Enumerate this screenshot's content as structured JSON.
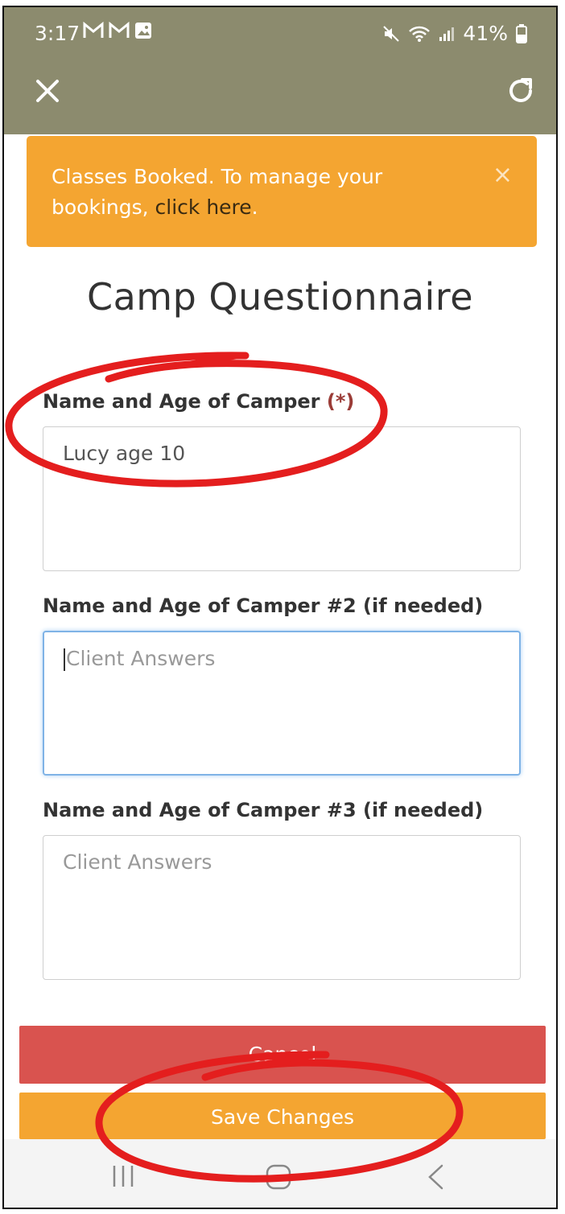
{
  "status_bar": {
    "time": "3:17",
    "notifications": [
      "gmail-icon",
      "gmail-icon",
      "image-icon"
    ],
    "battery": "41%"
  },
  "alert": {
    "text_prefix": "Classes Booked. To manage your bookings, ",
    "link_text": "click here",
    "text_suffix": ".",
    "close_label": "×"
  },
  "page": {
    "title": "Camp Questionnaire"
  },
  "form": {
    "fields": [
      {
        "label": "Name and Age of Camper",
        "required_mark": "(*)",
        "value": "Lucy age 10",
        "placeholder": "Client Answers"
      },
      {
        "label": "Name and Age of Camper #2 (if needed)",
        "value": "",
        "placeholder": "Client Answers"
      },
      {
        "label": "Name and Age of Camper #3 (if needed)",
        "value": "",
        "placeholder": "Client Answers"
      }
    ]
  },
  "buttons": {
    "cancel": "Cancel",
    "save": "Save Changes"
  },
  "colors": {
    "header": "#8c8b6e",
    "alert": "#f4a531",
    "cancel": "#d9534f",
    "save": "#f4a531",
    "annotation": "#e41e1e"
  }
}
